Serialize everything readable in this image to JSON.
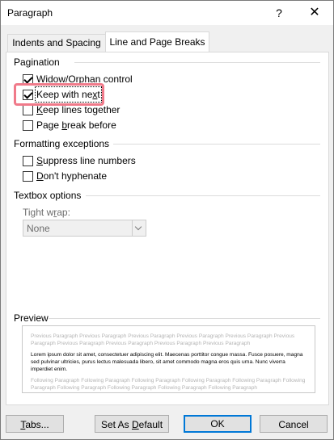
{
  "window": {
    "title": "Paragraph",
    "help": "?",
    "close": "✕"
  },
  "tabs": [
    {
      "label": "Indents and Spacing",
      "active": false
    },
    {
      "label": "Line and Page Breaks",
      "active": true
    }
  ],
  "pagination": {
    "title": "Pagination",
    "widow": {
      "pre": "",
      "u": "W",
      "post": "idow/Orphan control",
      "checked": true
    },
    "keep_next": {
      "pre": "Keep with ne",
      "u": "x",
      "post": "t",
      "checked": true
    },
    "keep_lines": {
      "pre": "",
      "u": "K",
      "post": "eep lines together",
      "checked": false
    },
    "page_break": {
      "pre": "Page ",
      "u": "b",
      "post": "reak before",
      "checked": false
    }
  },
  "formatting": {
    "title": "Formatting exceptions",
    "suppress": {
      "pre": "",
      "u": "S",
      "post": "uppress line numbers",
      "checked": false
    },
    "hyphenate": {
      "pre": "",
      "u": "D",
      "post": "on't hyphenate",
      "checked": false
    }
  },
  "textbox": {
    "title": "Textbox options",
    "tight_wrap": {
      "pre": "Tight w",
      "u": "r",
      "post": "ap:"
    },
    "select_value": "None"
  },
  "preview": {
    "title": "Preview",
    "previous": "Previous Paragraph Previous Paragraph Previous Paragraph Previous Paragraph Previous Paragraph Previous Paragraph Previous Paragraph Previous Paragraph Previous Paragraph Previous Paragraph",
    "current": "Lorem ipsum dolor sit amet, consectetuer adipiscing elit. Maecenas porttitor congue massa. Fusce posuere, magna sed pulvinar ultricies, purus lectus malesuada libero, sit amet commodo magna eros quis urna. Nunc viverra imperdiet enim.",
    "following": "Following Paragraph Following Paragraph Following Paragraph Following Paragraph Following Paragraph Following Paragraph Following Paragraph Following Paragraph Following Paragraph Following Paragraph"
  },
  "buttons": {
    "tabs": {
      "pre": "",
      "u": "T",
      "post": "abs..."
    },
    "default": {
      "pre": "Set As ",
      "u": "D",
      "post": "efault"
    },
    "ok": "OK",
    "cancel": "Cancel"
  },
  "colors": {
    "highlight": "#f07a8a",
    "ok_border": "#0078d7"
  }
}
